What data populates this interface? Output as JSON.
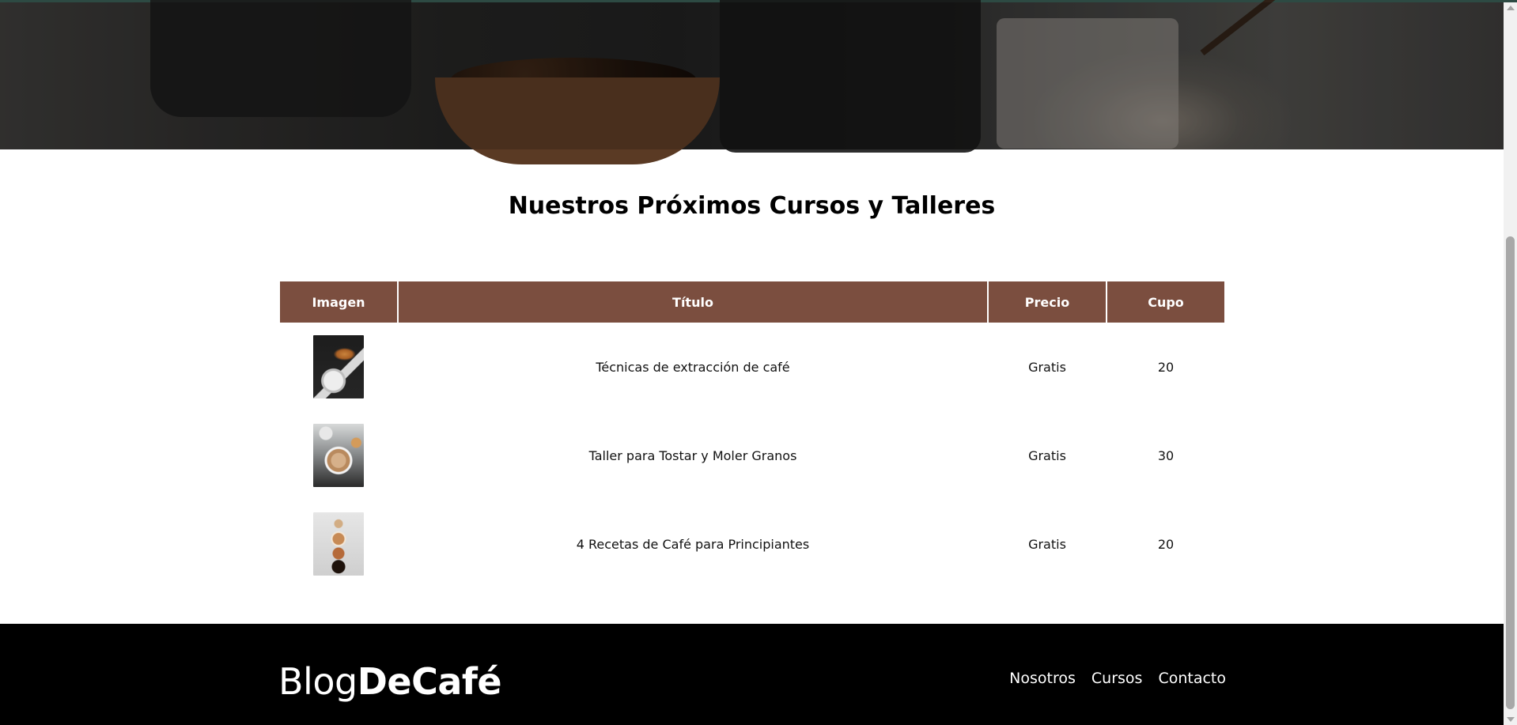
{
  "hero": {
    "alt": "coffee background"
  },
  "section": {
    "title": "Nuestros Próximos Cursos y Talleres"
  },
  "table": {
    "headers": [
      "Imagen",
      "Título",
      "Precio",
      "Cupo"
    ],
    "rows": [
      {
        "image_icon": "coffee-croissant-image",
        "title": "Técnicas de extracción de café",
        "price": "Gratis",
        "cupo": "20"
      },
      {
        "image_icon": "latte-art-image",
        "title": "Taller para Tostar y Moler Granos",
        "price": "Gratis",
        "cupo": "30"
      },
      {
        "image_icon": "coffee-cups-image",
        "title": "4 Recetas de Café para Principiantes",
        "price": "Gratis",
        "cupo": "20"
      }
    ]
  },
  "footer": {
    "brand_regular": "Blog",
    "brand_bold": "DeCafé",
    "nav": [
      "Nosotros",
      "Cursos",
      "Contacto"
    ]
  },
  "colors": {
    "table_header": "#7b4e3f",
    "footer_bg": "#000000"
  }
}
